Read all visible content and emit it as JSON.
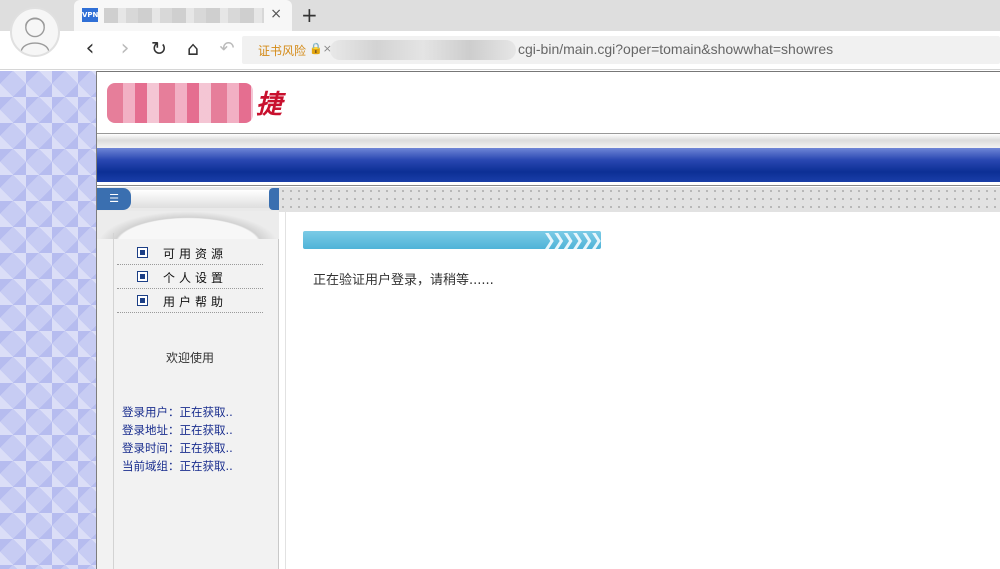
{
  "browser": {
    "tab_favicon": "VPN",
    "tab_close": "×",
    "new_tab": "+",
    "url_warning": "证书风险",
    "url_lock": "🔒×",
    "url_visible": "cgi-bin/main.cgi?oper=tomain&showwhat=showres",
    "nav": {
      "back": "‹",
      "forward": "›",
      "reload": "↻",
      "home": "⌂",
      "undo": "↶"
    }
  },
  "header": {
    "logo_char": "捷"
  },
  "sidebar": {
    "top_icon": "☰",
    "menu": [
      {
        "label": "可用资源"
      },
      {
        "label": "个人设置"
      },
      {
        "label": "用户帮助"
      }
    ],
    "welcome": "欢迎使用",
    "info": [
      {
        "label": "登录用户：",
        "value": "正在获取.."
      },
      {
        "label": "登录地址：",
        "value": "正在获取.."
      },
      {
        "label": "登录时间：",
        "value": "正在获取.."
      },
      {
        "label": "当前域组：",
        "value": "正在获取.."
      }
    ]
  },
  "main": {
    "progress_arrows": "❯❯❯❯❯❯",
    "status_text": "正在验证用户登录，请稍等......"
  },
  "colors": {
    "blue_band": "#0c2f95",
    "logo_red": "#c8102e",
    "progress": "#4fb3d8",
    "info_text": "#1b2f8f"
  }
}
